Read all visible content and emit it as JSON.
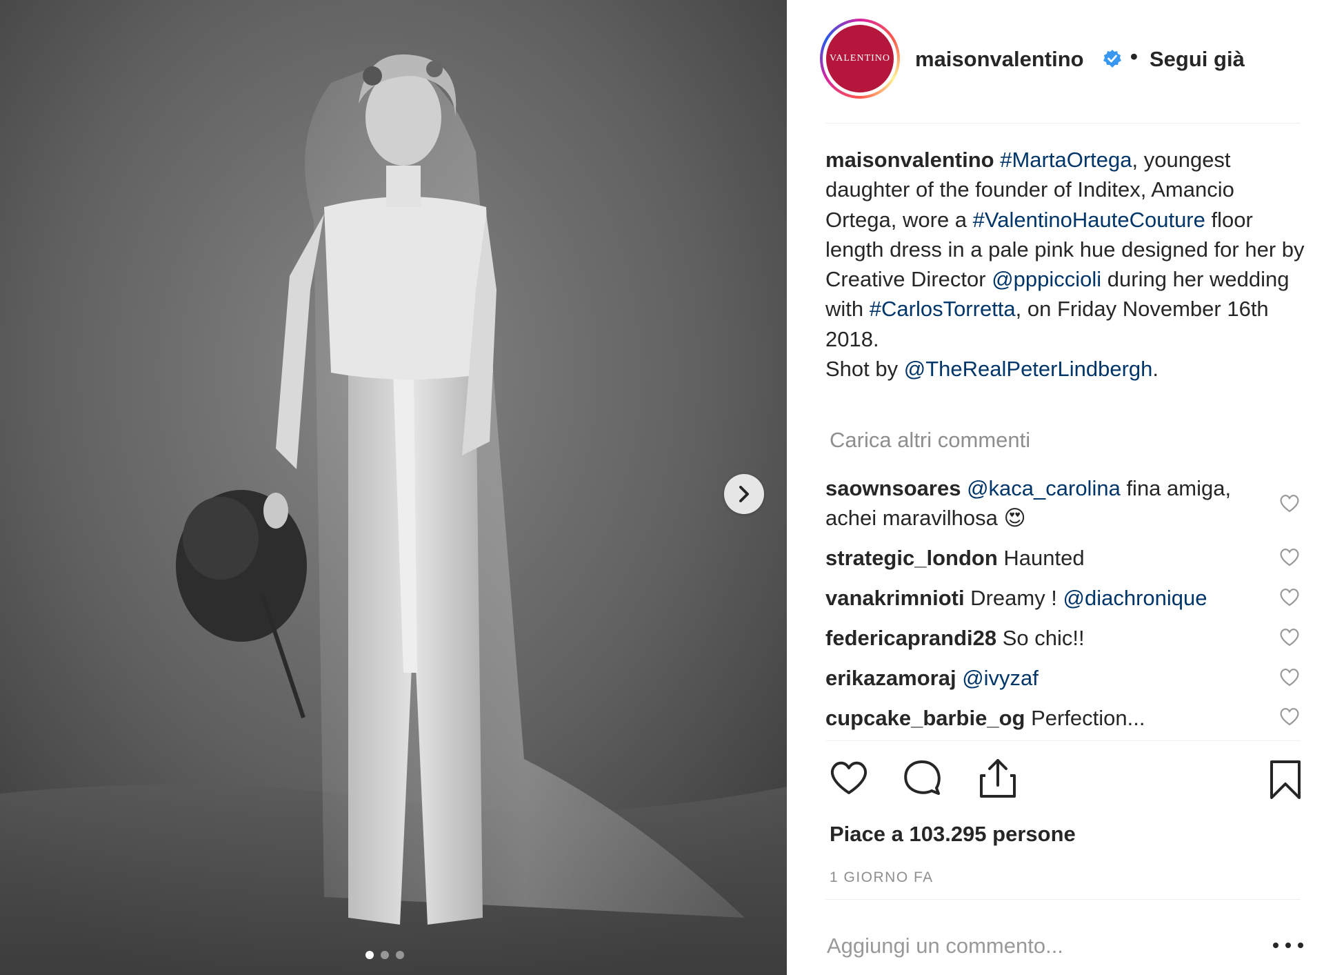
{
  "header": {
    "avatar_text": "VALENTINO",
    "username": "maisonvalentino",
    "separator": "•",
    "follow_status": "Segui già",
    "verified_color": "#3897f0"
  },
  "caption": {
    "username": "maisonvalentino",
    "p1": " ",
    "tag1": "#MartaOrtega",
    "p2": ", youngest daughter of the founder of Inditex, Amancio Ortega, wore a ",
    "tag2": "#ValentinoHauteCouture",
    "p3": " floor length dress in a pale pink hue designed for her by Creative Director ",
    "mention1": "@pppiccioli",
    "p4": " during her wedding with ",
    "tag3": "#CarlosTorretta",
    "p5": ", on Friday November 16th 2018.",
    "p6": "Shot by ",
    "mention2": "@TheRealPeterLindbergh",
    "p7": "."
  },
  "load_more": "Carica altri commenti",
  "comments": [
    {
      "user": "saownsoares",
      "mention": "@kaca_carolina",
      "text": " fina amiga, achei maravilhosa ",
      "emoji": "😍"
    },
    {
      "user": "strategic_london",
      "text": " Haunted"
    },
    {
      "user": "vanakrimnioti",
      "text": " Dreamy ! ",
      "mention": "@diachronique"
    },
    {
      "user": "federicaprandi28",
      "text": " So chic!!"
    },
    {
      "user": "erikazamoraj",
      "text": " ",
      "mention": "@ivyzaf"
    },
    {
      "user": "cupcake_barbie_og",
      "text": " Perfection..."
    }
  ],
  "likes": "Piace a 103.295 persone",
  "timestamp": "1 GIORNO FA",
  "comment_input": {
    "placeholder": "Aggiungi un commento..."
  },
  "carousel": {
    "dots": 3,
    "active": 1
  },
  "colors": {
    "link": "#003569",
    "text": "#262626",
    "muted": "#8e8e8e",
    "brand": "#b5163c"
  }
}
